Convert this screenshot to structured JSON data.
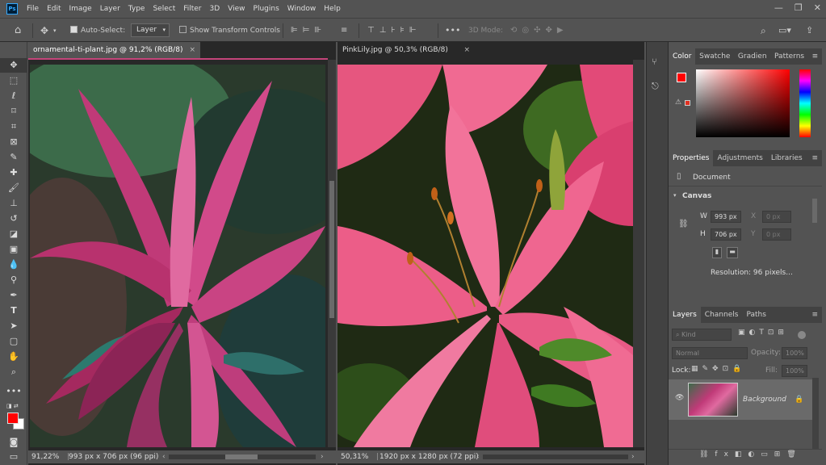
{
  "app_logo": "Ps",
  "menu": [
    "File",
    "Edit",
    "Image",
    "Layer",
    "Type",
    "Select",
    "Filter",
    "3D",
    "View",
    "Plugins",
    "Window",
    "Help"
  ],
  "window_controls": {
    "minimize": "—",
    "restore": "❐",
    "close": "✕"
  },
  "options": {
    "auto_select_label": "Auto-Select:",
    "auto_select_target": "Layer",
    "transform_label": "Show Transform Controls",
    "mode_3d": "3D Mode:"
  },
  "doc1": {
    "tab": "ornamental-ti-plant.jpg @ 91,2% (RGB/8)",
    "close": "×",
    "zoom": "91,22%",
    "info": "993 px x 706 px (96 ppi)"
  },
  "doc2": {
    "tab": "PinkLily.jpg @ 50,3% (RGB/8)",
    "close": "×",
    "zoom": "50,31%",
    "info": "1920 px x 1280 px (72 ppi)"
  },
  "color_panel": {
    "tabs": [
      "Color",
      "Swatche",
      "Gradien",
      "Patterns"
    ],
    "foreground": "#ff0000"
  },
  "properties": {
    "tabs": [
      "Properties",
      "Adjustments",
      "Libraries"
    ],
    "doc_label": "Document",
    "section": "Canvas",
    "w_label": "W",
    "w_value": "993 px",
    "h_label": "H",
    "h_value": "706 px",
    "x_label": "X",
    "x_placeholder": "0 px",
    "y_label": "Y",
    "y_placeholder": "0 px",
    "resolution": "Resolution: 96 pixels..."
  },
  "layers": {
    "tabs": [
      "Layers",
      "Channels",
      "Paths"
    ],
    "kind": "Kind",
    "blend": "Normal",
    "opacity_label": "Opacity:",
    "opacity_value": "100%",
    "lock_label": "Lock:",
    "fill_label": "Fill:",
    "fill_value": "100%",
    "layer_name": "Background"
  }
}
